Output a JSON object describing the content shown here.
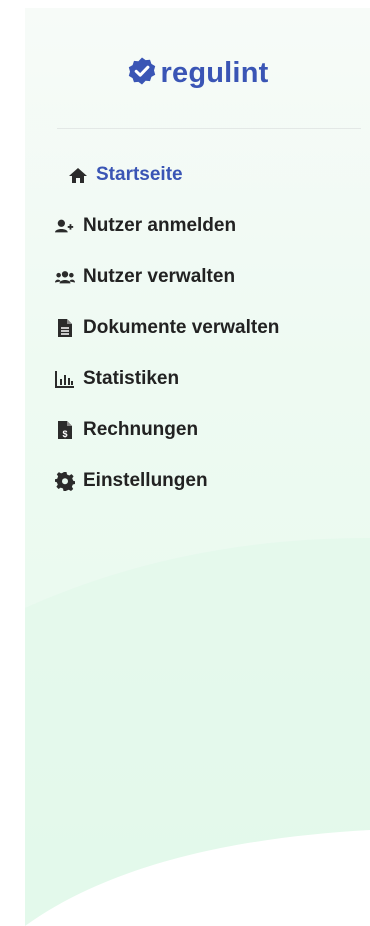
{
  "brand": {
    "name": "regulint",
    "icon": "check-badge-icon",
    "color": "#3a55b5"
  },
  "nav": {
    "items": [
      {
        "label": "Startseite",
        "icon": "home-icon",
        "active": true
      },
      {
        "label": "Nutzer anmelden",
        "icon": "user-plus-icon",
        "active": false
      },
      {
        "label": "Nutzer verwalten",
        "icon": "users-icon",
        "active": false
      },
      {
        "label": "Dokumente verwalten",
        "icon": "document-icon",
        "active": false
      },
      {
        "label": "Statistiken",
        "icon": "bar-chart-icon",
        "active": false
      },
      {
        "label": "Rechnungen",
        "icon": "invoice-icon",
        "active": false
      },
      {
        "label": "Einstellungen",
        "icon": "gear-icon",
        "active": false
      }
    ]
  }
}
